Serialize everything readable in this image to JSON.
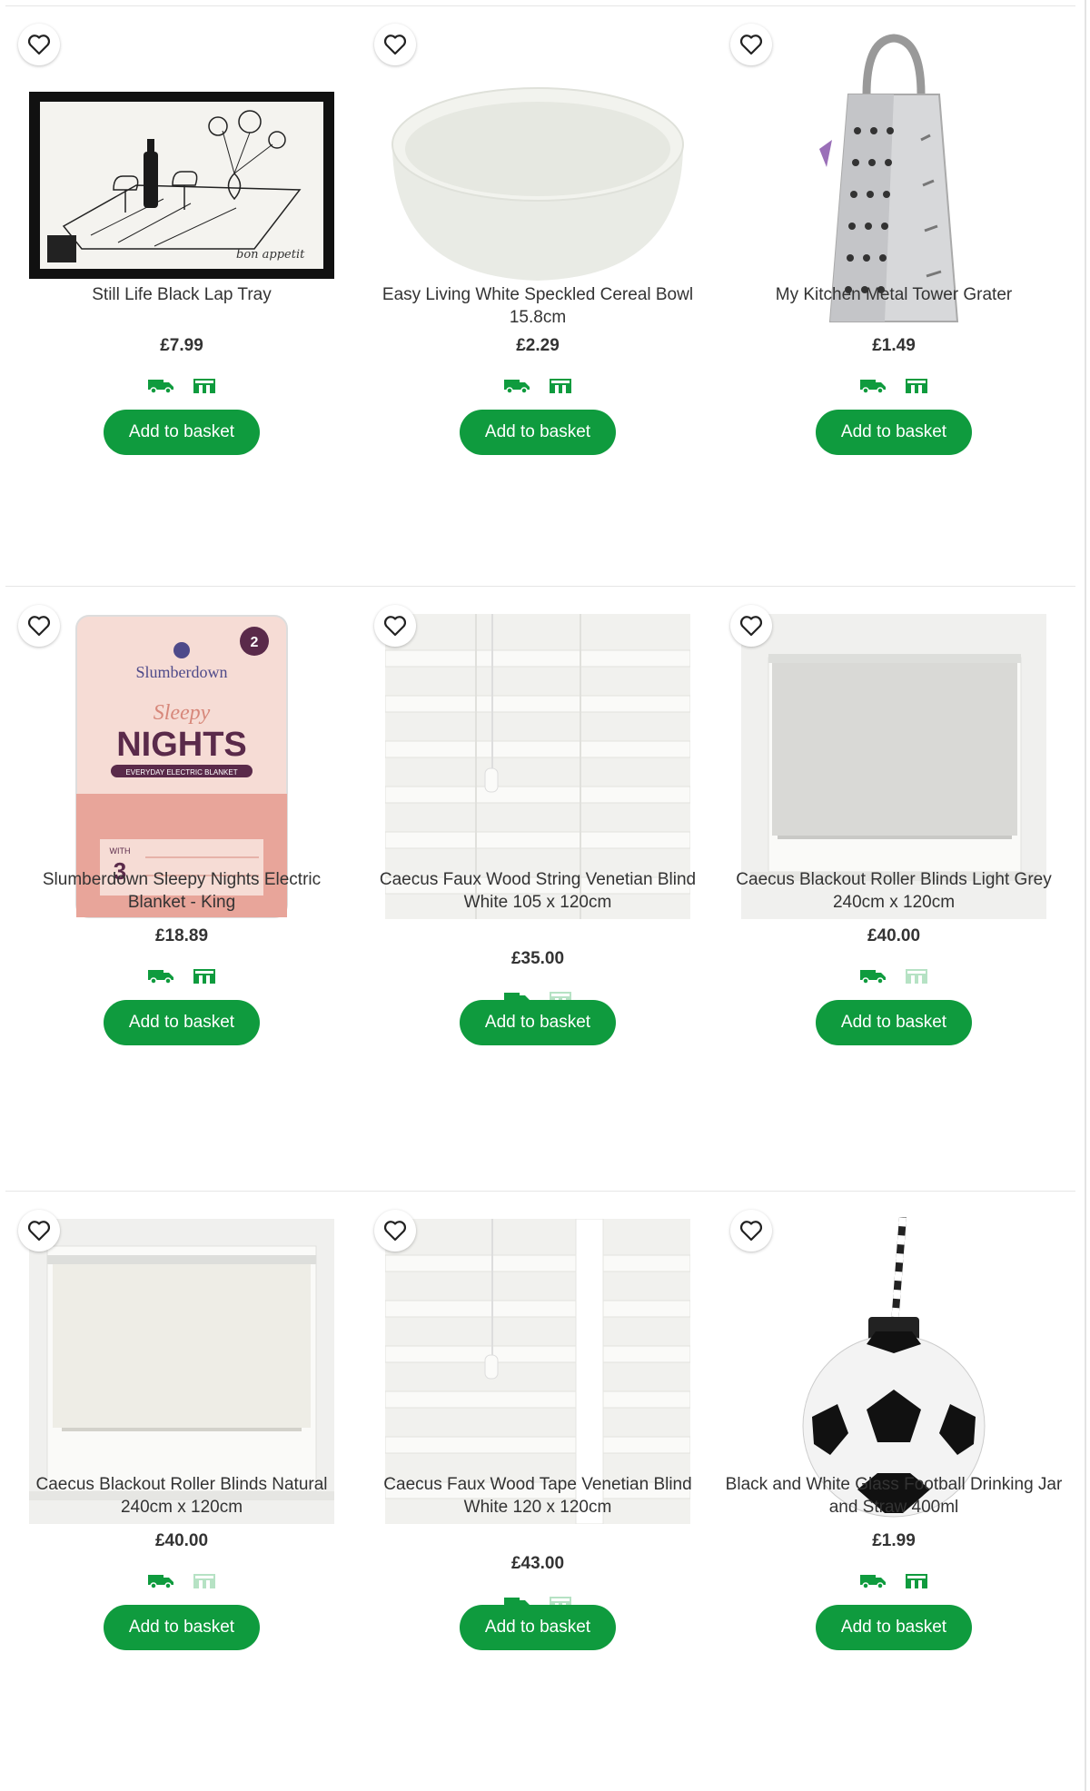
{
  "products": [
    {
      "name": "Still Life Black Lap Tray",
      "price": "£7.99",
      "click_collect": "available",
      "button": "Add to basket"
    },
    {
      "name": "Easy Living White Speckled Cereal Bowl 15.8cm",
      "price": "£2.29",
      "click_collect": "available",
      "button": "Add to basket"
    },
    {
      "name": "My Kitchen Metal Tower Grater",
      "price": "£1.49",
      "click_collect": "available",
      "button": "Add to basket"
    },
    {
      "name": "Slumberdown Sleepy Nights Electric Blanket - King",
      "price": "£18.89",
      "click_collect": "available",
      "button": "Add to basket"
    },
    {
      "name": "Caecus Faux Wood String Venetian Blind White 105 x 120cm",
      "price": "£35.00",
      "click_collect": "unavailable",
      "button": "Add to basket"
    },
    {
      "name": "Caecus Blackout Roller Blinds Light Grey 240cm x 120cm",
      "price": "£40.00",
      "click_collect": "unavailable",
      "button": "Add to basket"
    },
    {
      "name": "Caecus Blackout Roller Blinds Natural 240cm x 120cm",
      "price": "£40.00",
      "click_collect": "unavailable",
      "button": "Add to basket"
    },
    {
      "name": "Caecus Faux Wood Tape Venetian Blind White 120 x 120cm",
      "price": "£43.00",
      "click_collect": "unavailable",
      "button": "Add to basket"
    },
    {
      "name": "Black and White Glass Football Drinking Jar and Straw 400ml",
      "price": "£1.99",
      "click_collect": "available",
      "button": "Add to basket"
    }
  ],
  "packaging_text": {
    "brand": "Slumberdown",
    "years": "2",
    "sleepy": "Sleepy",
    "nights": "NIGHTS",
    "subtitle": "EVERYDAY ELECTRIC BLANKET",
    "with": "WITH",
    "settings_num": "3",
    "tray_script": "bon appetit"
  },
  "colors": {
    "brand_green": "#0f9b3e",
    "icon_unavailable": "#b6e2c4"
  }
}
